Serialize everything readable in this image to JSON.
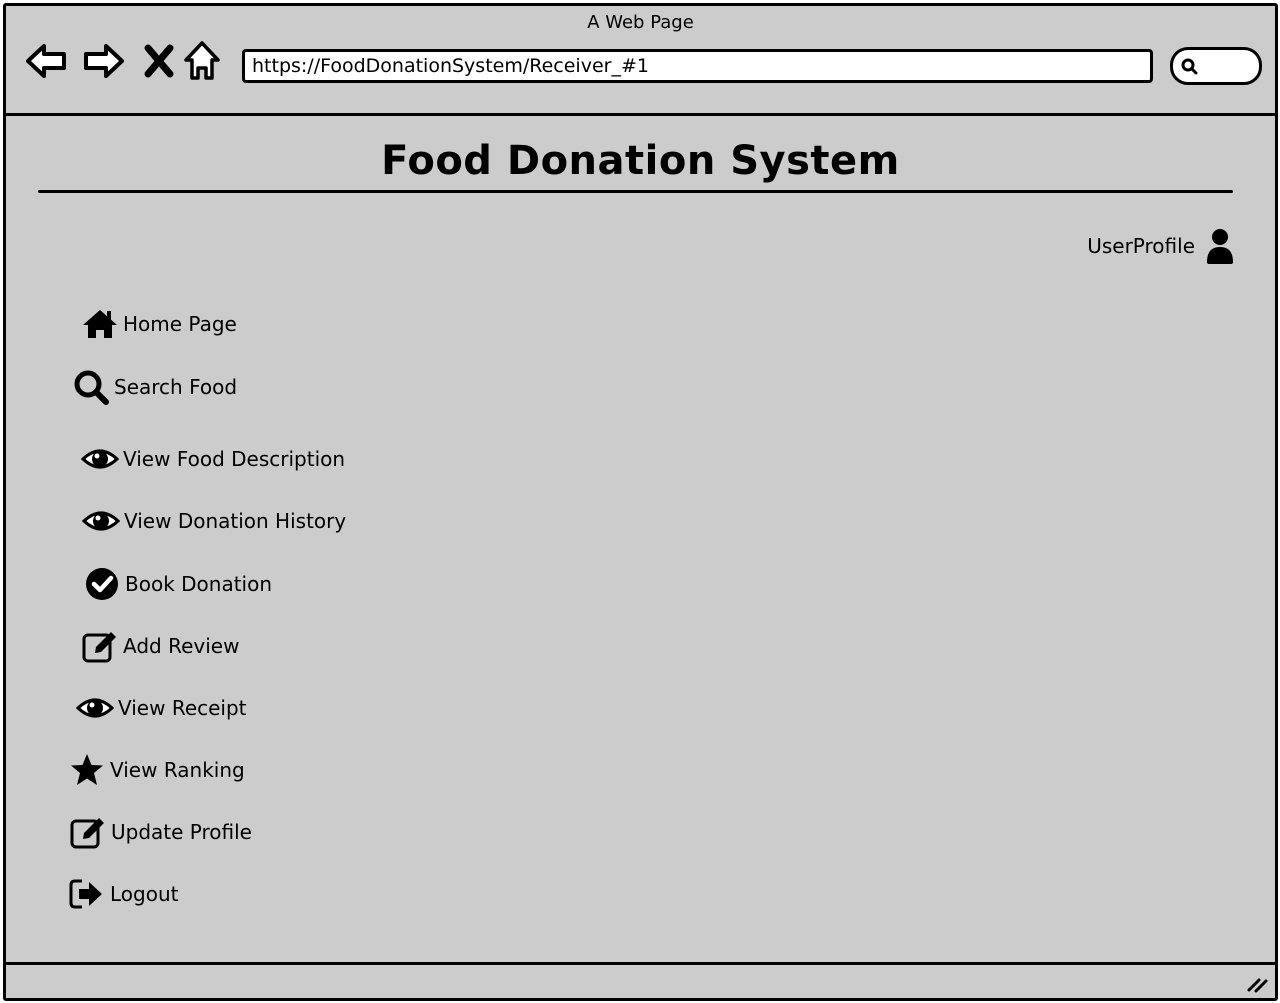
{
  "window": {
    "title": "A Web Page"
  },
  "browser": {
    "url": "https://FoodDonationSystem/Receiver_#1",
    "nav_icons": [
      "back-arrow-icon",
      "forward-arrow-icon",
      "stop-icon",
      "home-icon"
    ],
    "search_icon": "search-icon"
  },
  "page": {
    "title": "Food Donation System",
    "user_profile": {
      "label": "UserProfile",
      "icon": "user-icon"
    }
  },
  "menu": [
    {
      "label": "Home Page",
      "icon": "home-icon"
    },
    {
      "label": "Search Food",
      "icon": "search-icon"
    },
    {
      "label": "View Food Description",
      "icon": "eye-icon"
    },
    {
      "label": "View Donation History",
      "icon": "eye-icon"
    },
    {
      "label": "Book Donation",
      "icon": "check-circle-icon"
    },
    {
      "label": "Add Review",
      "icon": "edit-icon"
    },
    {
      "label": "View Receipt",
      "icon": "eye-icon"
    },
    {
      "label": "View Ranking",
      "icon": "star-icon"
    },
    {
      "label": "Update Profile",
      "icon": "edit-icon"
    },
    {
      "label": "Logout",
      "icon": "logout-icon"
    }
  ]
}
